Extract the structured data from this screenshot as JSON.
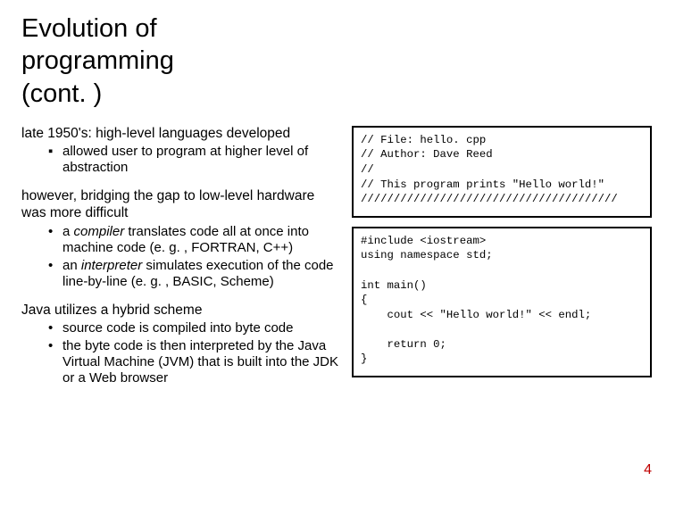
{
  "title": "Evolution of\nprogramming\n(cont. )",
  "left": {
    "p1": "late 1950's: high-level languages developed",
    "b1": "allowed user to program at higher level of abstraction",
    "p2": "however, bridging the gap to low-level hardware was more difficult",
    "c1_pre": "a ",
    "c1_em": "compiler",
    "c1_post": " translates code all at once into machine code (e. g. , FORTRAN, C++)",
    "c2_pre": "an ",
    "c2_em": "interpreter",
    "c2_post": " simulates execution of the code line-by-line (e. g. , BASIC, Scheme)",
    "p3": "Java utilizes a hybrid scheme",
    "d1": "source code is compiled into byte code",
    "d2": "the byte code is then interpreted by the Java Virtual Machine (JVM) that is built into the JDK or a Web browser"
  },
  "code": {
    "box1": "// File: hello. cpp\n// Author: Dave Reed\n//\n// This program prints \"Hello world!\"\n///////////////////////////////////////",
    "box2": "#include <iostream>\nusing namespace std;\n\nint main()\n{\n    cout << \"Hello world!\" << endl;\n\n    return 0;\n}"
  },
  "page_number": "4"
}
